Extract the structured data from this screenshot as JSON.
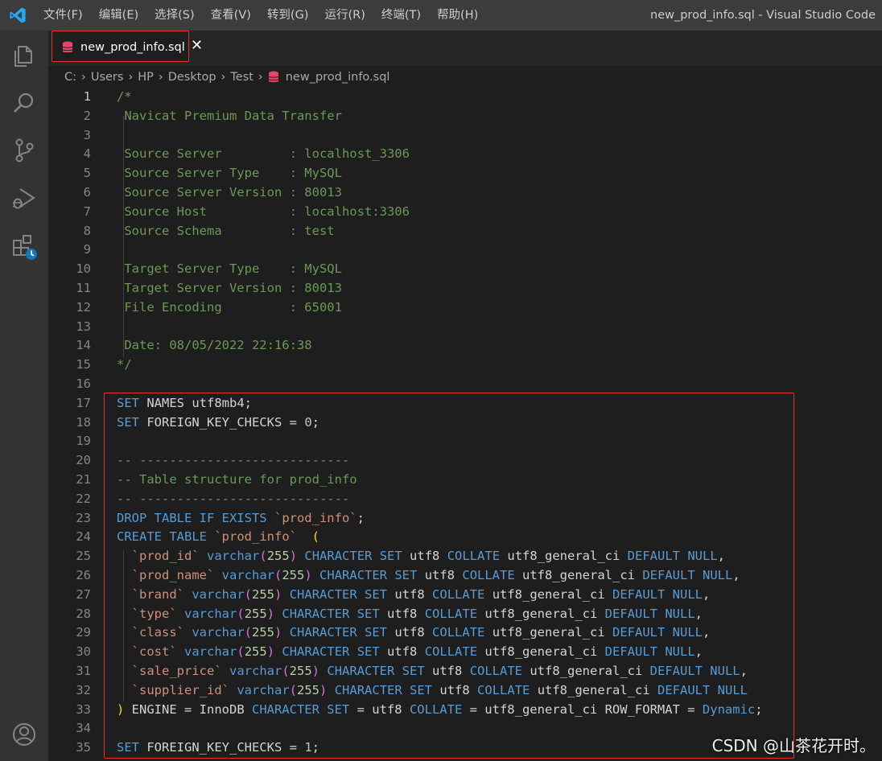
{
  "titlebar": {
    "menu": [
      "文件(F)",
      "编辑(E)",
      "选择(S)",
      "查看(V)",
      "转到(G)",
      "运行(R)",
      "终端(T)",
      "帮助(H)"
    ],
    "window_title": "new_prod_info.sql - Visual Studio Code"
  },
  "activitybar": {
    "icons": [
      "explorer-icon",
      "search-icon",
      "source-control-icon",
      "run-debug-icon",
      "extensions-icon",
      "account-icon"
    ]
  },
  "tab": {
    "name": "new_prod_info.sql",
    "close": "✕"
  },
  "breadcrumb": [
    "C:",
    "Users",
    "HP",
    "Desktop",
    "Test",
    "new_prod_info.sql"
  ],
  "editor": {
    "line_numbers": [
      "1",
      "2",
      "3",
      "4",
      "5",
      "6",
      "7",
      "8",
      "9",
      "10",
      "11",
      "12",
      "13",
      "14",
      "15",
      "16",
      "17",
      "18",
      "19",
      "20",
      "21",
      "22",
      "23",
      "24",
      "25",
      "26",
      "27",
      "28",
      "29",
      "30",
      "31",
      "32",
      "33",
      "34",
      "35"
    ],
    "lines": [
      [
        [
          "cm",
          "/*"
        ]
      ],
      [
        [
          "cm",
          " Navicat Premium Data Transfer"
        ]
      ],
      [],
      [
        [
          "cm",
          " Source Server         : localhost_3306"
        ]
      ],
      [
        [
          "cm",
          " Source Server Type    : MySQL"
        ]
      ],
      [
        [
          "cm",
          " Source Server Version : 80013"
        ]
      ],
      [
        [
          "cm",
          " Source Host           : localhost:3306"
        ]
      ],
      [
        [
          "cm",
          " Source Schema         : test"
        ]
      ],
      [],
      [
        [
          "cm",
          " Target Server Type    : MySQL"
        ]
      ],
      [
        [
          "cm",
          " Target Server Version : 80013"
        ]
      ],
      [
        [
          "cm",
          " File Encoding         : 65001"
        ]
      ],
      [],
      [
        [
          "cm",
          " Date: 08/05/2022 22:16:38"
        ]
      ],
      [
        [
          "cm",
          "*/"
        ]
      ],
      [],
      [
        [
          "kw",
          "SET"
        ],
        [
          "tx",
          " NAMES utf8mb4;"
        ]
      ],
      [
        [
          "kw",
          "SET"
        ],
        [
          "tx",
          " FOREIGN_KEY_CHECKS = "
        ],
        [
          "nm",
          "0"
        ],
        [
          "tx",
          ";"
        ]
      ],
      [],
      [
        [
          "cm",
          "-- ----------------------------"
        ]
      ],
      [
        [
          "cm",
          "-- Table structure for prod_info"
        ]
      ],
      [
        [
          "cm",
          "-- ----------------------------"
        ]
      ],
      [
        [
          "kw",
          "DROP TABLE IF EXISTS"
        ],
        [
          "tx",
          " "
        ],
        [
          "st",
          "`prod_info`"
        ],
        [
          "tx",
          ";"
        ]
      ],
      [
        [
          "kw",
          "CREATE TABLE"
        ],
        [
          "tx",
          " "
        ],
        [
          "st",
          "`prod_info`"
        ],
        [
          "tx",
          "  "
        ],
        [
          "br",
          "("
        ]
      ],
      [
        [
          "tx",
          "  "
        ],
        [
          "st",
          "`prod_id`"
        ],
        [
          "tx",
          " "
        ],
        [
          "fn",
          "varchar"
        ],
        [
          "br2",
          "("
        ],
        [
          "nm",
          "255"
        ],
        [
          "br2",
          ")"
        ],
        [
          "tx",
          " "
        ],
        [
          "kw",
          "CHARACTER SET"
        ],
        [
          "tx",
          " utf8 "
        ],
        [
          "kw",
          "COLLATE"
        ],
        [
          "tx",
          " utf8_general_ci "
        ],
        [
          "kw",
          "DEFAULT NULL"
        ],
        [
          "tx",
          ","
        ]
      ],
      [
        [
          "tx",
          "  "
        ],
        [
          "st",
          "`prod_name`"
        ],
        [
          "tx",
          " "
        ],
        [
          "fn",
          "varchar"
        ],
        [
          "br2",
          "("
        ],
        [
          "nm",
          "255"
        ],
        [
          "br2",
          ")"
        ],
        [
          "tx",
          " "
        ],
        [
          "kw",
          "CHARACTER SET"
        ],
        [
          "tx",
          " utf8 "
        ],
        [
          "kw",
          "COLLATE"
        ],
        [
          "tx",
          " utf8_general_ci "
        ],
        [
          "kw",
          "DEFAULT NULL"
        ],
        [
          "tx",
          ","
        ]
      ],
      [
        [
          "tx",
          "  "
        ],
        [
          "st",
          "`brand`"
        ],
        [
          "tx",
          " "
        ],
        [
          "fn",
          "varchar"
        ],
        [
          "br2",
          "("
        ],
        [
          "nm",
          "255"
        ],
        [
          "br2",
          ")"
        ],
        [
          "tx",
          " "
        ],
        [
          "kw",
          "CHARACTER SET"
        ],
        [
          "tx",
          " utf8 "
        ],
        [
          "kw",
          "COLLATE"
        ],
        [
          "tx",
          " utf8_general_ci "
        ],
        [
          "kw",
          "DEFAULT NULL"
        ],
        [
          "tx",
          ","
        ]
      ],
      [
        [
          "tx",
          "  "
        ],
        [
          "st",
          "`type`"
        ],
        [
          "tx",
          " "
        ],
        [
          "fn",
          "varchar"
        ],
        [
          "br2",
          "("
        ],
        [
          "nm",
          "255"
        ],
        [
          "br2",
          ")"
        ],
        [
          "tx",
          " "
        ],
        [
          "kw",
          "CHARACTER SET"
        ],
        [
          "tx",
          " utf8 "
        ],
        [
          "kw",
          "COLLATE"
        ],
        [
          "tx",
          " utf8_general_ci "
        ],
        [
          "kw",
          "DEFAULT NULL"
        ],
        [
          "tx",
          ","
        ]
      ],
      [
        [
          "tx",
          "  "
        ],
        [
          "st",
          "`class`"
        ],
        [
          "tx",
          " "
        ],
        [
          "fn",
          "varchar"
        ],
        [
          "br2",
          "("
        ],
        [
          "nm",
          "255"
        ],
        [
          "br2",
          ")"
        ],
        [
          "tx",
          " "
        ],
        [
          "kw",
          "CHARACTER SET"
        ],
        [
          "tx",
          " utf8 "
        ],
        [
          "kw",
          "COLLATE"
        ],
        [
          "tx",
          " utf8_general_ci "
        ],
        [
          "kw",
          "DEFAULT NULL"
        ],
        [
          "tx",
          ","
        ]
      ],
      [
        [
          "tx",
          "  "
        ],
        [
          "st",
          "`cost`"
        ],
        [
          "tx",
          " "
        ],
        [
          "fn",
          "varchar"
        ],
        [
          "br2",
          "("
        ],
        [
          "nm",
          "255"
        ],
        [
          "br2",
          ")"
        ],
        [
          "tx",
          " "
        ],
        [
          "kw",
          "CHARACTER SET"
        ],
        [
          "tx",
          " utf8 "
        ],
        [
          "kw",
          "COLLATE"
        ],
        [
          "tx",
          " utf8_general_ci "
        ],
        [
          "kw",
          "DEFAULT NULL"
        ],
        [
          "tx",
          ","
        ]
      ],
      [
        [
          "tx",
          "  "
        ],
        [
          "st",
          "`sale_price`"
        ],
        [
          "tx",
          " "
        ],
        [
          "fn",
          "varchar"
        ],
        [
          "br2",
          "("
        ],
        [
          "nm",
          "255"
        ],
        [
          "br2",
          ")"
        ],
        [
          "tx",
          " "
        ],
        [
          "kw",
          "CHARACTER SET"
        ],
        [
          "tx",
          " utf8 "
        ],
        [
          "kw",
          "COLLATE"
        ],
        [
          "tx",
          " utf8_general_ci "
        ],
        [
          "kw",
          "DEFAULT NULL"
        ],
        [
          "tx",
          ","
        ]
      ],
      [
        [
          "tx",
          "  "
        ],
        [
          "st",
          "`supplier_id`"
        ],
        [
          "tx",
          " "
        ],
        [
          "fn",
          "varchar"
        ],
        [
          "br2",
          "("
        ],
        [
          "nm",
          "255"
        ],
        [
          "br2",
          ")"
        ],
        [
          "tx",
          " "
        ],
        [
          "kw",
          "CHARACTER SET"
        ],
        [
          "tx",
          " utf8 "
        ],
        [
          "kw",
          "COLLATE"
        ],
        [
          "tx",
          " utf8_general_ci "
        ],
        [
          "kw",
          "DEFAULT NULL"
        ]
      ],
      [
        [
          "br",
          ")"
        ],
        [
          "tx",
          " ENGINE = InnoDB "
        ],
        [
          "kw",
          "CHARACTER SET"
        ],
        [
          "tx",
          " = utf8 "
        ],
        [
          "kw",
          "COLLATE"
        ],
        [
          "tx",
          " = utf8_general_ci ROW_FORMAT = "
        ],
        [
          "kw",
          "Dynamic"
        ],
        [
          "tx",
          ";"
        ]
      ],
      [],
      [
        [
          "kw",
          "SET"
        ],
        [
          "tx",
          " FOREIGN_KEY_CHECKS = "
        ],
        [
          "nm",
          "1"
        ],
        [
          "tx",
          ";"
        ]
      ]
    ]
  },
  "watermark": "CSDN @山茶花开时。",
  "colors": {
    "highlight_border": "#e0332f",
    "comment": "#6a9955",
    "keyword": "#569cd6",
    "string": "#ce9178",
    "number": "#b5cea8"
  }
}
